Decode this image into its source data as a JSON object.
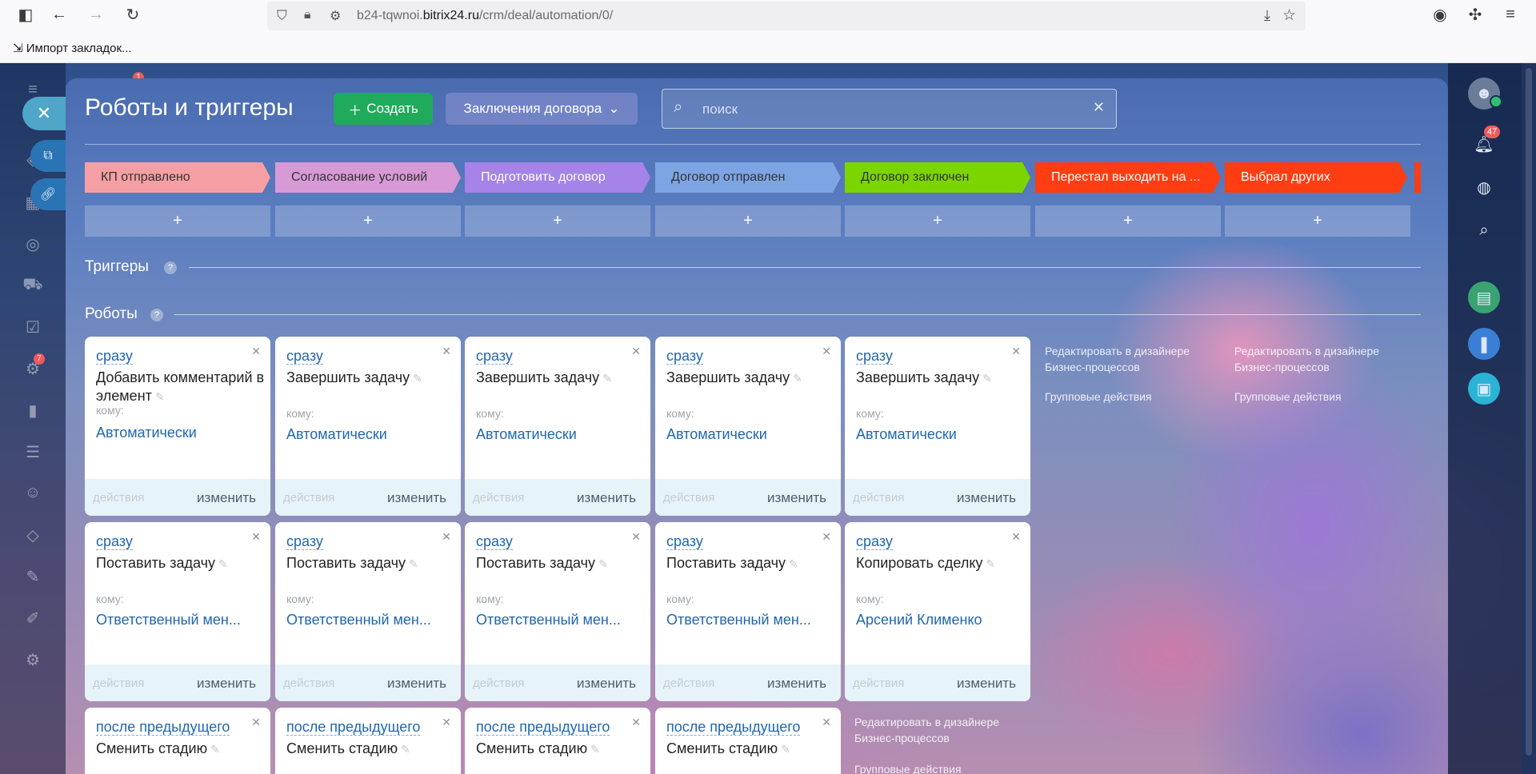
{
  "browser": {
    "url_prefix": "b24-tqwnoi.",
    "url_domain": "bitrix24.ru",
    "url_path": "/crm/deal/automation/0/",
    "bookmark_label": "Импорт закладок..."
  },
  "header": {
    "title": "Роботы и триггеры",
    "create_label": "Создать",
    "pipeline_label": "Заключения договора",
    "search_placeholder": "поиск"
  },
  "notifications": {
    "count": "47"
  },
  "left_rail": {
    "badge_top": "1",
    "badge_tasks": "7"
  },
  "stages": [
    {
      "label": "КП отправлено",
      "bg": "#f59fa5",
      "fg": "#333333"
    },
    {
      "label": "Согласование условий",
      "bg": "#d79ad6",
      "fg": "#333333"
    },
    {
      "label": "Подготовить договор",
      "bg": "#a583e8",
      "fg": "#ffffff"
    },
    {
      "label": "Договор отправлен",
      "bg": "#7da5e3",
      "fg": "#333333"
    },
    {
      "label": "Договор заключен",
      "bg": "#7bd500",
      "fg": "#333333"
    },
    {
      "label": "Перестал выходить на ...",
      "bg": "#ff3d13",
      "fg": "#ffffff"
    },
    {
      "label": "Выбрал других",
      "bg": "#ff3d13",
      "fg": "#ffffff"
    }
  ],
  "add_symbol": "+",
  "triggers": {
    "title": "Триггеры"
  },
  "robots": {
    "title": "Роботы",
    "to_label": "кому:",
    "actions_label": "действия",
    "edit_label": "изменить",
    "designer_label": "Редактировать в дизайнере Бизнес-процессов",
    "group_label": "Групповые действия",
    "rows": [
      [
        {
          "when": "сразу",
          "name": "Добавить комментарий в элемент",
          "value": "Автоматически"
        },
        {
          "when": "сразу",
          "name": "Завершить задачу",
          "value": "Автоматически"
        },
        {
          "when": "сразу",
          "name": "Завершить задачу",
          "value": "Автоматически"
        },
        {
          "when": "сразу",
          "name": "Завершить задачу",
          "value": "Автоматически"
        },
        {
          "when": "сразу",
          "name": "Завершить задачу",
          "value": "Автоматически"
        }
      ],
      [
        {
          "when": "сразу",
          "name": "Поставить задачу",
          "value": "Ответственный мен..."
        },
        {
          "when": "сразу",
          "name": "Поставить задачу",
          "value": "Ответственный мен..."
        },
        {
          "when": "сразу",
          "name": "Поставить задачу",
          "value": "Ответственный мен..."
        },
        {
          "when": "сразу",
          "name": "Поставить задачу",
          "value": "Ответственный мен..."
        },
        {
          "when": "сразу",
          "name": "Копировать сделку",
          "value": "Арсений Клименко"
        }
      ],
      [
        {
          "when": "после предыдущего",
          "name": "Сменить стадию"
        },
        {
          "when": "после предыдущего",
          "name": "Сменить стадию"
        },
        {
          "when": "после предыдущего",
          "name": "Сменить стадию"
        },
        {
          "when": "после предыдущего",
          "name": "Сменить стадию"
        }
      ]
    ]
  }
}
